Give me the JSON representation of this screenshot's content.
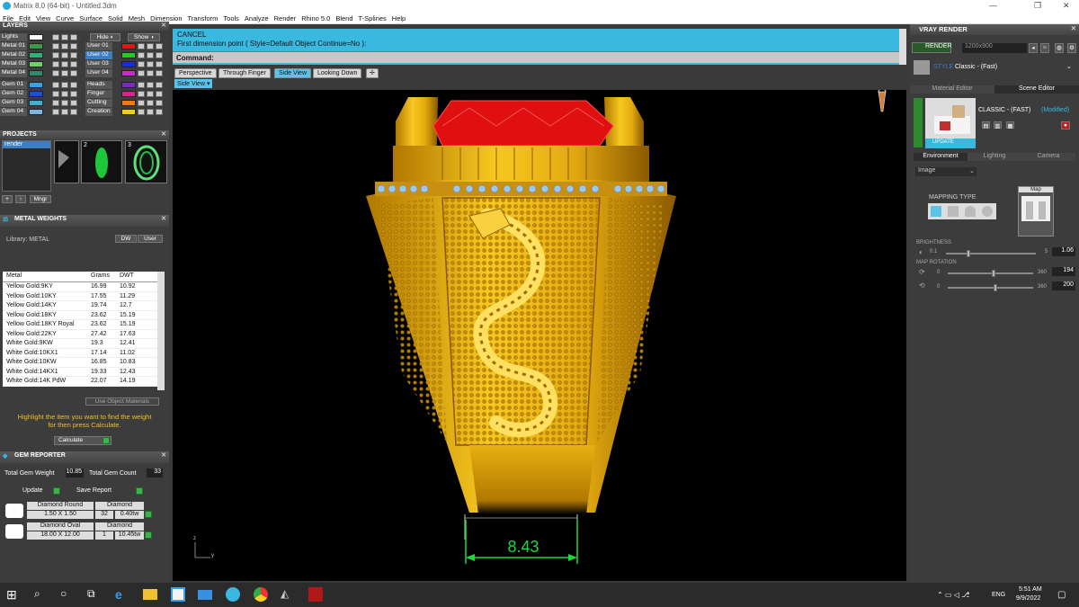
{
  "window": {
    "title": "Matrix 8.0 (64-bit) - Untitled.3dm",
    "minimize": "—",
    "maximize": "❐",
    "close": "✕"
  },
  "menu": [
    "File",
    "Edit",
    "View",
    "Curve",
    "Surface",
    "Solid",
    "Mesh",
    "Dimension",
    "Transform",
    "Tools",
    "Analyze",
    "Render",
    "Rhino 5.0",
    "Blend",
    "T-Splines",
    "Help"
  ],
  "layers": {
    "title": "LAYERS",
    "hide": "Hide",
    "show": "Show",
    "left": [
      {
        "name": "Lights",
        "color": "#ffffff"
      },
      {
        "name": "Metal 01",
        "color": "#3a9c4a"
      },
      {
        "name": "Metal 02",
        "color": "#2ab27a"
      },
      {
        "name": "Metal 03",
        "color": "#6bd36b"
      },
      {
        "name": "Metal 04",
        "color": "#2c8c6a"
      },
      {
        "name": "Gem 01",
        "color": "#3aa0e0"
      },
      {
        "name": "Gem 02",
        "color": "#1e4fd0"
      },
      {
        "name": "Gem 03",
        "color": "#3fb0c8"
      },
      {
        "name": "Gem 04",
        "color": "#7ab6e0"
      }
    ],
    "right": [
      {
        "name": "User 01",
        "color": "#e01818"
      },
      {
        "name": "User 02",
        "color": "#1ed01e"
      },
      {
        "name": "User 03",
        "color": "#1a2ae0"
      },
      {
        "name": "User 04",
        "color": "#c82acb"
      },
      {
        "name": "Heads",
        "color": "#7a2ac0"
      },
      {
        "name": "Finger",
        "color": "#e01e8c"
      },
      {
        "name": "Cutting",
        "color": "#f07a10"
      },
      {
        "name": "Creation",
        "color": "#f0d010"
      }
    ]
  },
  "projects": {
    "title": "PROJECTS",
    "item": "render",
    "n2": "2",
    "n3": "3",
    "mngr": "Mngr"
  },
  "metal_weights": {
    "title": "METAL WEIGHTS",
    "library": "Library: METAL",
    "dw": "DW",
    "user": "User",
    "headers": [
      "Metal",
      "Grams",
      "DWT"
    ],
    "rows": [
      [
        "Yellow Gold:9KY",
        "16.99",
        "10.92"
      ],
      [
        "Yellow Gold:10KY",
        "17.55",
        "11.29"
      ],
      [
        "Yellow Gold:14KY",
        "19.74",
        "12.7"
      ],
      [
        "Yellow Gold:18KY",
        "23.62",
        "15.19"
      ],
      [
        "Yellow Gold:18KY Royal",
        "23.62",
        "15.19"
      ],
      [
        "Yellow Gold:22KY",
        "27.42",
        "17.63"
      ],
      [
        "White Gold:9KW",
        "19.3",
        "12.41"
      ],
      [
        "White Gold:10KX1",
        "17.14",
        "11.02"
      ],
      [
        "White Gold:10KW",
        "16.85",
        "10.83"
      ],
      [
        "White Gold:14KX1",
        "19.33",
        "12.43"
      ],
      [
        "White Gold:14K PdW",
        "22.07",
        "14.19"
      ]
    ],
    "use_obj": "Use Object Materials",
    "hint1": "Highlight the item you want to find the weight",
    "hint2": "for then press Calculate.",
    "calculate": "Calculate"
  },
  "gem_reporter": {
    "title": "GEM REPORTER",
    "total_weight_label": "Total Gem Weight",
    "total_weight": "10.85",
    "total_count_label": "Total Gem Count",
    "total_count": "33",
    "update": "Update",
    "save": "Save Report",
    "gems": [
      {
        "name": "Diamond Round",
        "size": "1.50 X 1.50",
        "type": "Diamond",
        "count": "32",
        "ct": "0.40tw"
      },
      {
        "name": "Diamond Oval",
        "size": "18.00 X 12.00",
        "type": "Diamond",
        "count": "1",
        "ct": "10.45tw"
      }
    ]
  },
  "command": {
    "line1": "CANCEL",
    "line2": "First dimension point ( Style=Default  Object  Continue=No ):",
    "prompt": "Command:"
  },
  "view_tabs": [
    "Perspective",
    "Through Finger",
    "Side View",
    "Looking Down"
  ],
  "viewport_label": "Side View",
  "dimension": "8.43",
  "axis": {
    "z": "z",
    "y": "y"
  },
  "vray": {
    "title": "VRAY RENDER",
    "render": "RENDER",
    "resolution": "1200x900",
    "style_label": "STYLE",
    "style": "Classic - (Fast)",
    "tabs": [
      "Material Editor",
      "Scene Editor"
    ],
    "classic": "CLASSIC - (FAST)",
    "modified": "(Modified)",
    "update": "UPDATE",
    "env_tabs": [
      "Environment",
      "Lighting",
      "Camera"
    ],
    "image": "Image",
    "mapping": "MAPPING TYPE",
    "map": "Map",
    "brightness": "BRIGHTNESS",
    "b_min": "0.1",
    "b_max": "5",
    "b_val": "1.06",
    "b_level": 0.25,
    "rotation": "MAP ROTATION",
    "r_min": "0",
    "r_max": "360",
    "r1": "194",
    "r2": "200",
    "r1_level": 0.54,
    "r2_level": 0.56
  },
  "taskbar": {
    "time": "5:51 AM",
    "date": "9/9/2022",
    "lang": "ENG"
  }
}
